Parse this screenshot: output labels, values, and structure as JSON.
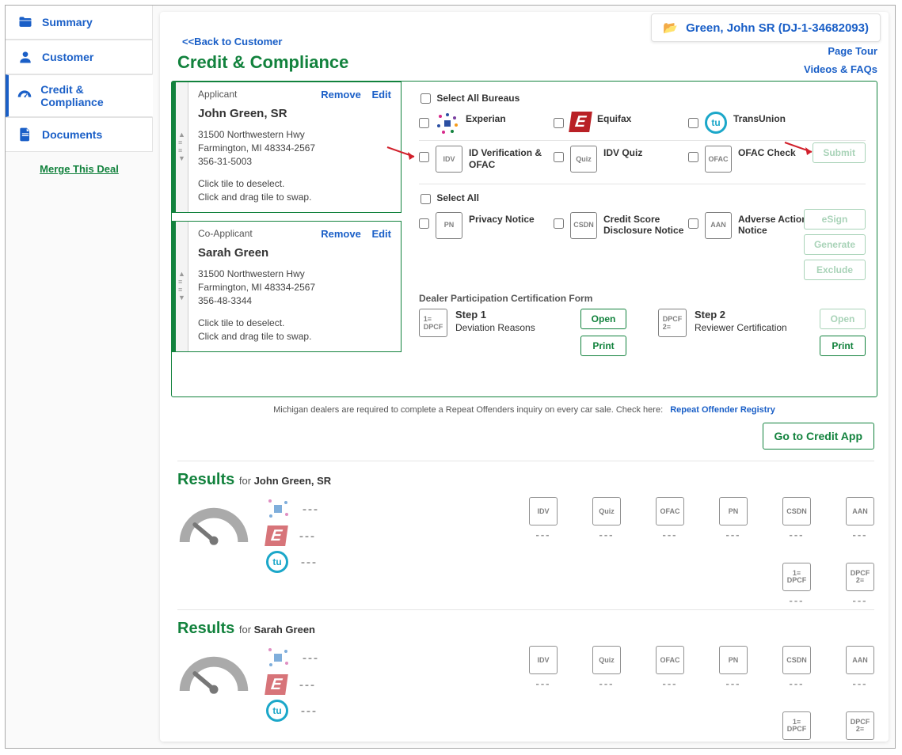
{
  "customer_badge": "Green, John SR (DJ-1-34682093)",
  "sidebar": {
    "items": [
      {
        "label": "Summary"
      },
      {
        "label": "Customer"
      },
      {
        "label": "Credit & Compliance"
      },
      {
        "label": "Documents"
      }
    ],
    "merge": "Merge This Deal"
  },
  "back_link": "<<Back to Customer",
  "page_title": "Credit & Compliance",
  "top_links": {
    "tour": "Page Tour",
    "videos": "Videos & FAQs"
  },
  "tiles": [
    {
      "role": "Applicant",
      "name": "John Green, SR",
      "addr1": "31500 Northwestern Hwy",
      "addr2": "Farmington, MI 48334-2567",
      "ssn": "356-31-5003",
      "hint1": "Click tile to deselect.",
      "hint2": "Click and drag tile to swap.",
      "remove": "Remove",
      "edit": "Edit"
    },
    {
      "role": "Co-Applicant",
      "name": "Sarah Green",
      "addr1": "31500 Northwestern Hwy",
      "addr2": "Farmington, MI 48334-2567",
      "ssn": "356-48-3344",
      "hint1": "Click tile to deselect.",
      "hint2": "Click and drag tile to swap.",
      "remove": "Remove",
      "edit": "Edit"
    }
  ],
  "checks": {
    "select_all_bureaus": "Select All Bureaus",
    "bureaus": [
      "Experian",
      "Equifax",
      "TransUnion"
    ],
    "verif": [
      "ID Verification & OFAC",
      "IDV Quiz",
      "OFAC Check"
    ],
    "submit": "Submit",
    "select_all": "Select All",
    "notices": [
      "Privacy Notice",
      "Credit Score Disclosure Notice",
      "Adverse Action Notice"
    ],
    "esign": "eSign",
    "generate": "Generate",
    "exclude": "Exclude"
  },
  "dpcf": {
    "title": "Dealer Participation Certification Form",
    "step1": {
      "title": "Step 1",
      "sub": "Deviation Reasons"
    },
    "step2": {
      "title": "Step 2",
      "sub": "Reviewer Certification"
    },
    "open": "Open",
    "print": "Print"
  },
  "footnote": {
    "text": "Michigan dealers are required to complete a Repeat Offenders inquiry on every car sale. Check here:",
    "link": "Repeat Offender Registry"
  },
  "goto_credit": "Go to Credit App",
  "results": {
    "title": "Results",
    "for_label": "for",
    "applicants": [
      "John Green, SR",
      "Sarah Green"
    ],
    "card_labels": [
      "IDV",
      "Quiz",
      "OFAC",
      "PN",
      "CSDN",
      "AAN",
      "DPCF 1",
      "DPCF 2"
    ],
    "dash": "---"
  }
}
